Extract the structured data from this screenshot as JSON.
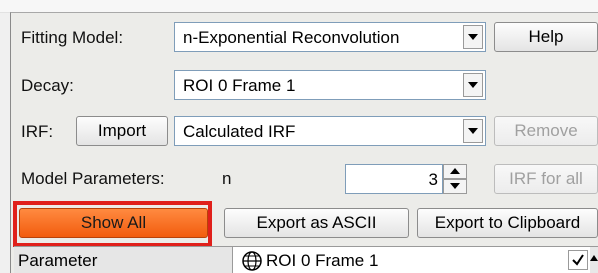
{
  "fitting_model": {
    "label": "Fitting Model:",
    "value": "n-Exponential Reconvolution",
    "help_label": "Help"
  },
  "decay": {
    "label": "Decay:",
    "value": "ROI 0 Frame 1"
  },
  "irf": {
    "label": "IRF:",
    "import_label": "Import",
    "value": "Calculated IRF",
    "remove_label": "Remove"
  },
  "model_parameters": {
    "label": "Model Parameters:",
    "n_label": "n",
    "n_value": "3",
    "irf_for_all_label": "IRF for all"
  },
  "actions": {
    "show_all_label": "Show All",
    "export_ascii_label": "Export as ASCII",
    "export_clipboard_label": "Export to Clipboard"
  },
  "table": {
    "parameter_header": "Parameter",
    "roi_header": "ROI 0 Frame 1"
  },
  "colors": {
    "show_all_button": "#f25c0e",
    "highlight_box": "#e0201b",
    "panel_background": "#ecece9"
  },
  "icons": [
    "dropdown-arrow-icon",
    "spinner-up-icon",
    "spinner-down-icon",
    "globe-icon",
    "checkmark-icon",
    "scroll-up-icon"
  ]
}
